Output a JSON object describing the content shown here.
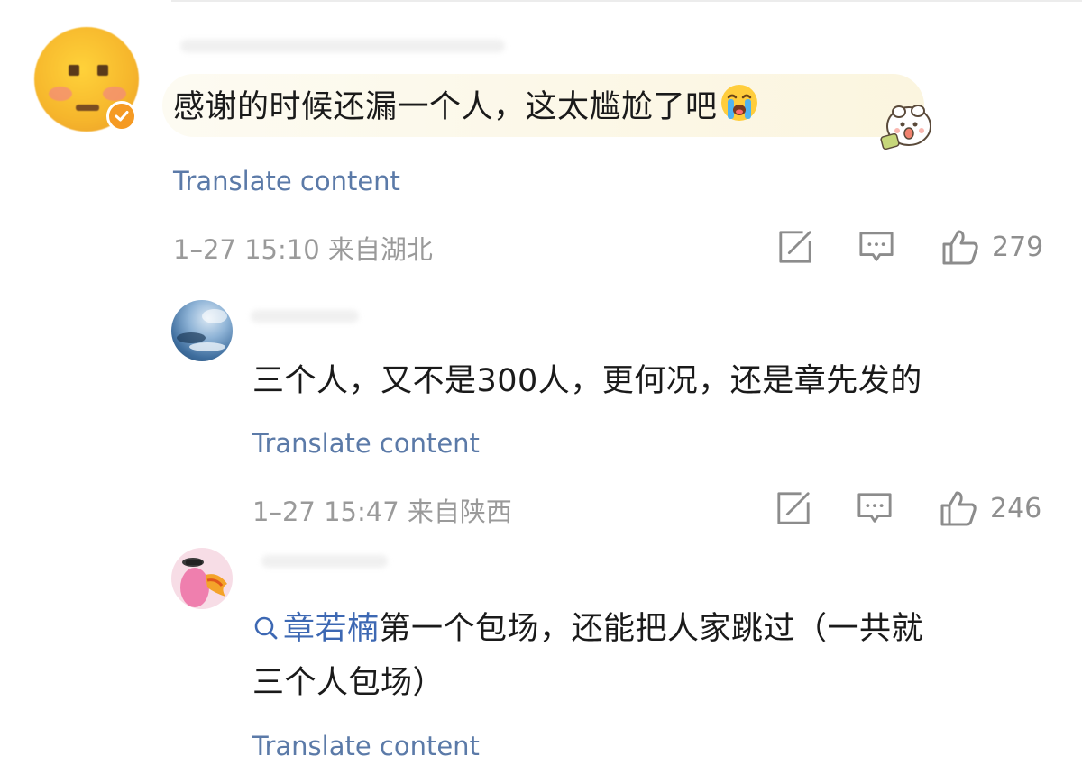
{
  "comments": [
    {
      "text": "感谢的时候还漏一个人，这太尴尬了吧",
      "emoji": "crying-face",
      "translate_label": "Translate content",
      "meta": "1–27 15:10 来自湖北",
      "likes": "279",
      "verified": true
    },
    {
      "text": "三个人，又不是300人，更何况，还是章先发的",
      "translate_label": "Translate content",
      "meta": "1–27 15:47 来自陕西",
      "likes": "246"
    },
    {
      "mention": "章若楠",
      "text_line1": "第一个包场，还能把人家跳过（一共就",
      "text_line2": "三个人包场）",
      "translate_label": "Translate content"
    }
  ],
  "icons": [
    "share-icon",
    "comment-icon",
    "like-icon",
    "search-mention-icon",
    "verified-icon"
  ],
  "colors": {
    "link": "#5b7aa8",
    "mention": "#3d68b3",
    "meta": "#9a9a9a",
    "badge": "#f59a23",
    "bubble": "#fbf5df"
  }
}
